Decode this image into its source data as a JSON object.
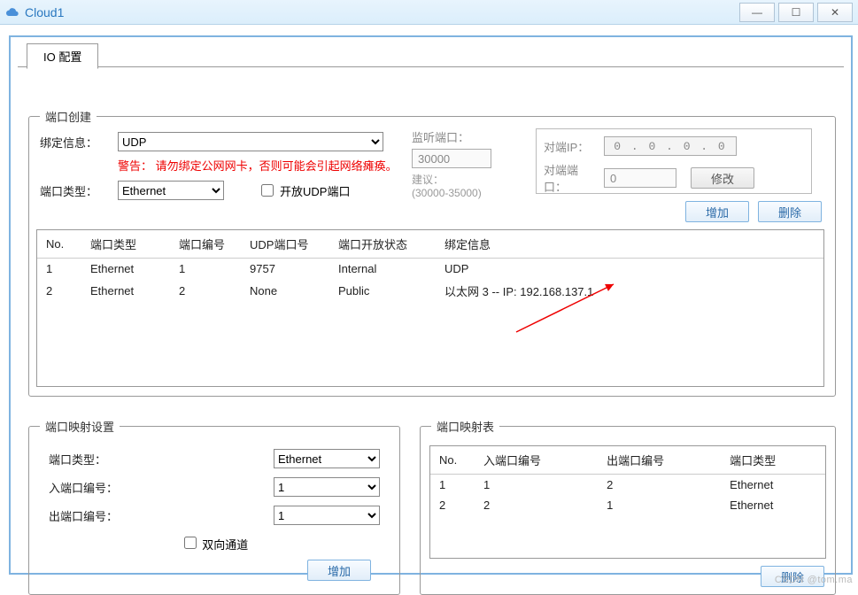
{
  "window": {
    "title": "Cloud1"
  },
  "tab": {
    "label": "IO 配置"
  },
  "port_create": {
    "legend": "端口创建",
    "bind_label": "绑定信息：",
    "bind_value": "UDP",
    "warning": "警告：    请勿绑定公网网卡，否则可能会引起网络瘫痪。",
    "type_label": "端口类型：",
    "type_value": "Ethernet",
    "open_udp_label": "开放UDP端口",
    "listen": {
      "label": "监听端口：",
      "value": "30000",
      "range": "建议：\n(30000-35000)"
    },
    "remote": {
      "ip_label": "对端IP：",
      "ip_value": "0 . 0 . 0 . 0",
      "port_label": "对端端口：",
      "port_value": "0",
      "modify": "修改"
    },
    "add_label": "增加",
    "del_label": "删除",
    "cols": {
      "no": "No.",
      "type": "端口类型",
      "num": "端口编号",
      "udp": "UDP端口号",
      "open": "端口开放状态",
      "bind": "绑定信息"
    },
    "rows": [
      {
        "no": "1",
        "type": "Ethernet",
        "num": "1",
        "udp": "9757",
        "open": "Internal",
        "bind": "UDP"
      },
      {
        "no": "2",
        "type": "Ethernet",
        "num": "2",
        "udp": "None",
        "open": "Public",
        "bind": "以太网 3 -- IP: 192.168.137.1"
      }
    ]
  },
  "map_set": {
    "legend": "端口映射设置",
    "type_label": "端口类型：",
    "type_value": "Ethernet",
    "in_label": "入端口编号：",
    "in_value": "1",
    "out_label": "出端口编号：",
    "out_value": "1",
    "bidir_label": "双向通道",
    "add": "增加"
  },
  "map_tbl": {
    "legend": "端口映射表",
    "cols": {
      "no": "No.",
      "in": "入端口编号",
      "out": "出端口编号",
      "type": "端口类型"
    },
    "rows": [
      {
        "no": "1",
        "in": "1",
        "out": "2",
        "type": "Ethernet"
      },
      {
        "no": "2",
        "in": "2",
        "out": "1",
        "type": "Ethernet"
      }
    ],
    "del": "删除"
  },
  "watermark": "CSDN @tom.ma"
}
